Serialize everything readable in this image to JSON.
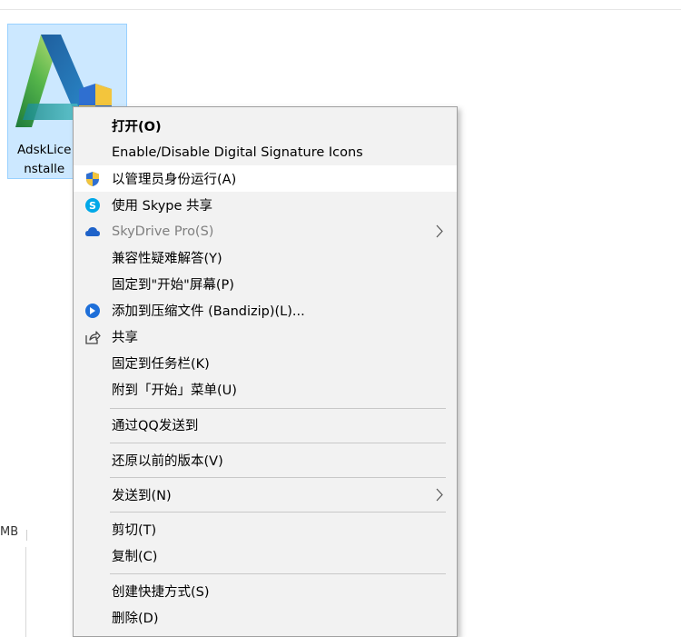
{
  "window": {
    "title_fragment": "打开(O)    ·  Digital Signature   ·   ·  Signature"
  },
  "file": {
    "name_line1": "AdskLice",
    "name_line2": "nstalle",
    "icon": "autodesk-logo-icon"
  },
  "status": {
    "size_text": "MB"
  },
  "context_menu": {
    "items": [
      {
        "label": "打开(O)",
        "icon": null
      },
      {
        "label": "Enable/Disable Digital Signature Icons",
        "icon": null
      },
      {
        "label": "以管理员身份运行(A)",
        "icon": "uac-shield-icon"
      },
      {
        "label": "使用 Skype 共享",
        "icon": "skype-icon"
      },
      {
        "label": "SkyDrive Pro(S)",
        "icon": "cloud-icon"
      },
      {
        "label": "兼容性疑难解答(Y)",
        "icon": null
      },
      {
        "label": "固定到\"开始\"屏幕(P)",
        "icon": null
      },
      {
        "label": "添加到压缩文件 (Bandizip)(L)...",
        "icon": "bandizip-icon"
      },
      {
        "label": "共享",
        "icon": "share-icon"
      },
      {
        "label": "固定到任务栏(K)",
        "icon": null
      },
      {
        "label": "附到「开始」菜单(U)",
        "icon": null
      },
      {
        "label": "通过QQ发送到",
        "icon": null
      },
      {
        "label": "还原以前的版本(V)",
        "icon": null
      },
      {
        "label": "发送到(N)",
        "icon": null
      },
      {
        "label": "剪切(T)",
        "icon": null
      },
      {
        "label": "复制(C)",
        "icon": null
      },
      {
        "label": "创建快捷方式(S)",
        "icon": null
      },
      {
        "label": "删除(D)",
        "icon": null
      }
    ]
  },
  "colors": {
    "selection_fill": "#cce8ff",
    "selection_border": "#99d1ff",
    "menu_bg": "#f2f2f2",
    "menu_highlight": "#ffffff",
    "disabled_text": "#7f7f7f"
  }
}
